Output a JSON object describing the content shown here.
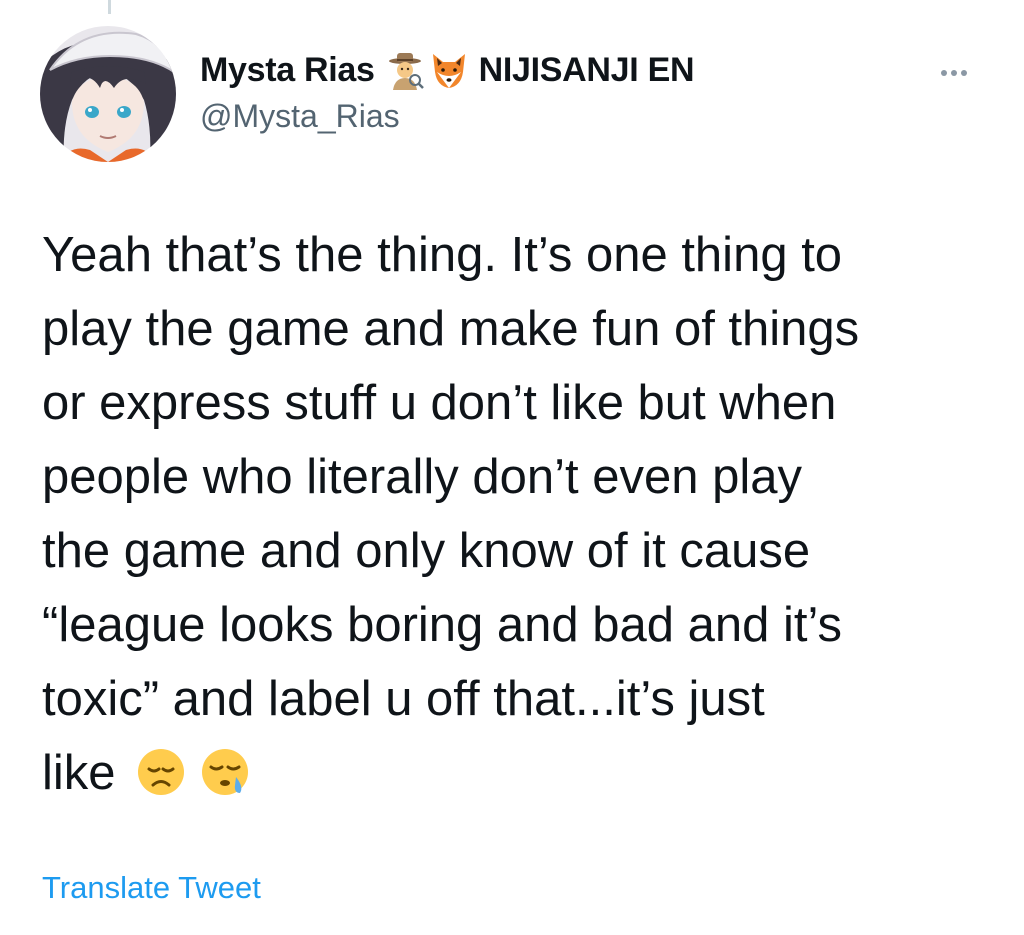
{
  "author": {
    "display_name": "Mysta Rias",
    "affiliation": "NIJISANJI EN",
    "handle": "@Mysta_Rias",
    "name_emojis": [
      "detective-emoji",
      "fox-emoji"
    ]
  },
  "tweet": {
    "lines": [
      "Yeah that’s the thing. It’s one thing to",
      "play the game and make fun of things",
      "or express stuff u don’t like but when",
      "people who literally don’t even play",
      "the game and only know of it cause",
      "“league looks boring and bad and it’s",
      "toxic” and label u off that...it’s just",
      "like"
    ],
    "trailing_emojis": [
      "disappointed-face-emoji",
      "sleepy-face-emoji"
    ]
  },
  "actions": {
    "translate_label": "Translate Tweet",
    "more_icon": "more-horizontal-icon"
  },
  "colors": {
    "text": "#0f1419",
    "secondary": "#536471",
    "link": "#1d9bf0",
    "background": "#ffffff"
  }
}
